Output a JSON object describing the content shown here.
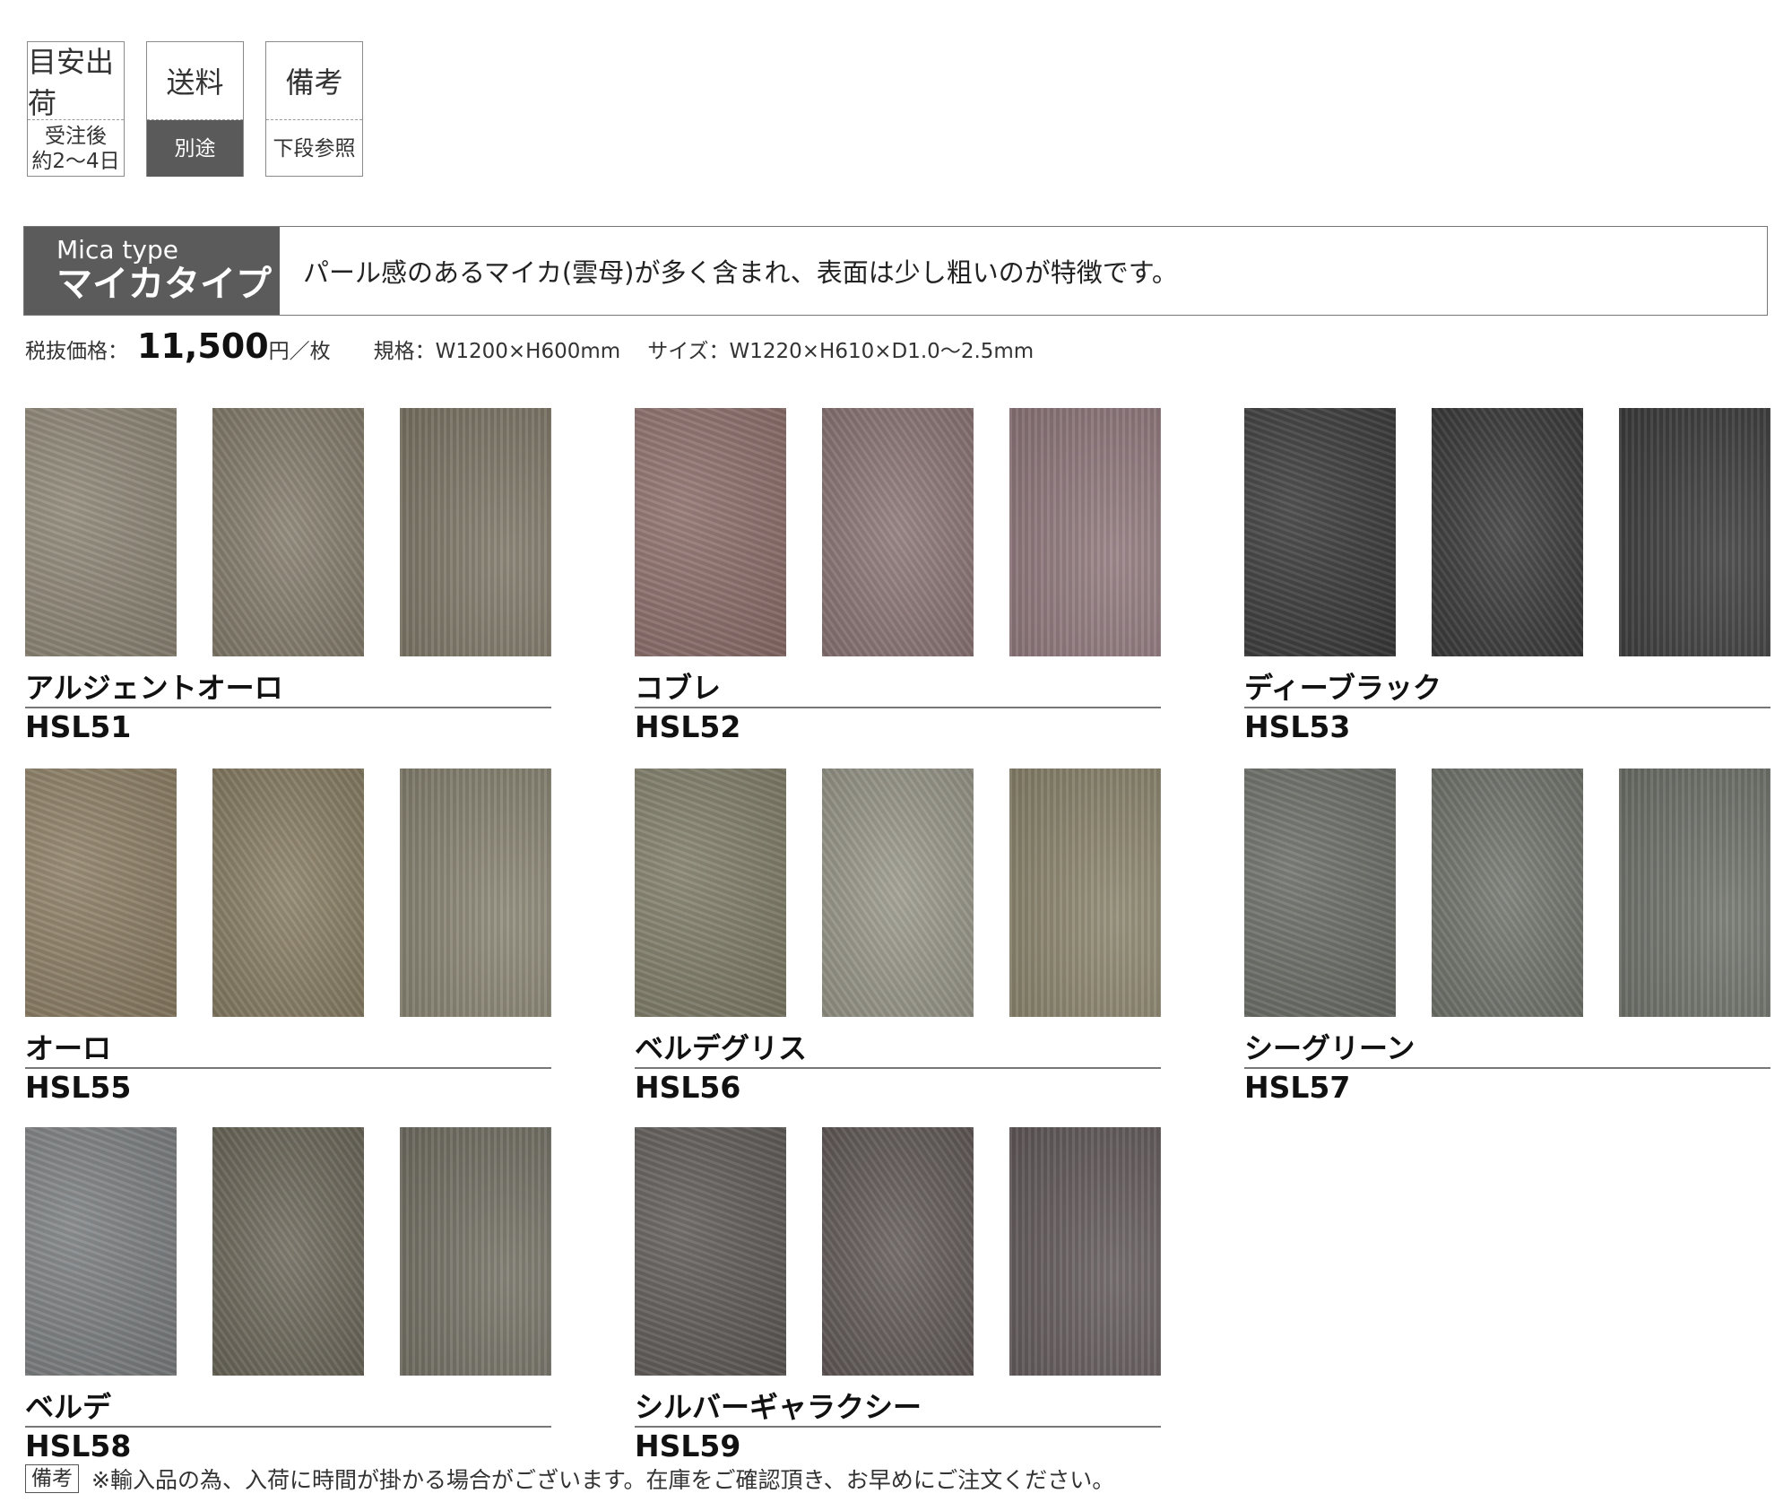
{
  "info_boxes": [
    {
      "title": "目安出荷",
      "value": "受注後\n約2〜4日",
      "dark": false
    },
    {
      "title": "送料",
      "value": "別途",
      "dark": true
    },
    {
      "title": "備考",
      "value": "下段参照",
      "dark": false
    }
  ],
  "type_banner": {
    "label_en": "Mica type",
    "label_jp": "マイカタイプ",
    "description": "パール感のあるマイカ(雲母)が多く含まれ、表面は少し粗いのが特徴です。"
  },
  "spec": {
    "price_label": "税抜価格：",
    "price_value": "11,500",
    "price_unit": "円／枚",
    "size_label": "規格：W1200×H600mm",
    "dimension_label": "サイズ：W1220×H610×D1.0〜2.5mm"
  },
  "products": [
    {
      "name": "アルジェントオーロ",
      "code": "HSL51",
      "colors": [
        "#8e8676",
        "#877f6f",
        "#7f7868"
      ]
    },
    {
      "name": "コブレ",
      "code": "HSL52",
      "colors": [
        "#8d6f6c",
        "#8e7777",
        "#927a7e"
      ]
    },
    {
      "name": "ディーブラック",
      "code": "HSL53",
      "colors": [
        "#3a3a3a",
        "#3c3c3c",
        "#3d3d3d"
      ]
    },
    {
      "name": "オーロ",
      "code": "HSL55",
      "colors": [
        "#8d7f65",
        "#8b8066",
        "#8a8573"
      ]
    },
    {
      "name": "ベルデグリス",
      "code": "HSL56",
      "colors": [
        "#807d69",
        "#9c9a8c",
        "#8d866f"
      ]
    },
    {
      "name": "シーグリーン",
      "code": "HSL57",
      "colors": [
        "#6b6e67",
        "#74776f",
        "#70736b"
      ]
    },
    {
      "name": "ベルデ",
      "code": "HSL58",
      "colors": [
        "#7d8082",
        "#6e6a5c",
        "#757266"
      ]
    },
    {
      "name": "シルバーギャラクシー",
      "code": "HSL59",
      "colors": [
        "#5f5b58",
        "#645c5a",
        "#655c5c"
      ]
    }
  ],
  "note": {
    "tag": "備考",
    "text": "※輸入品の為、入荷に時間が掛かる場合がございます。在庫をご確認頂き、お早めにご注文ください。"
  }
}
